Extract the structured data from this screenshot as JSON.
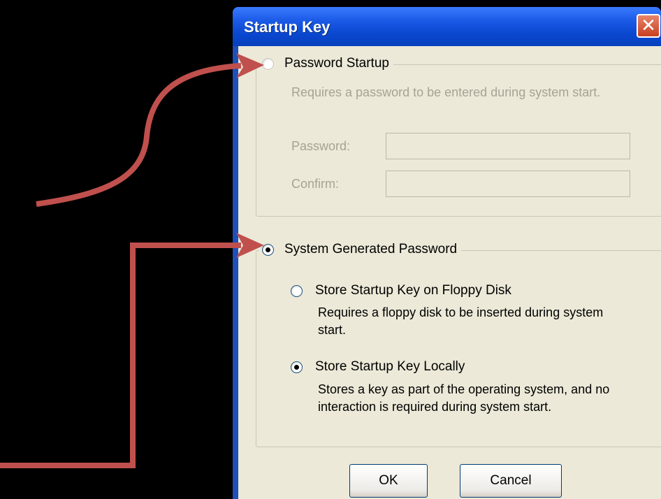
{
  "dialog": {
    "title": "Startup Key",
    "close_icon": "close-icon"
  },
  "password_startup": {
    "label": "Password Startup",
    "selected": false,
    "enabled": false,
    "description": "Requires a password to be entered during system start.",
    "password_label": "Password:",
    "confirm_label": "Confirm:",
    "password_value": "",
    "confirm_value": ""
  },
  "system_generated": {
    "label": "System Generated Password",
    "selected": true,
    "floppy": {
      "label": "Store Startup Key on Floppy Disk",
      "selected": false,
      "description": "Requires a floppy disk to be inserted during system start."
    },
    "local": {
      "label": "Store Startup Key Locally",
      "selected": true,
      "description": "Stores a key as part of the operating system, and no interaction is required during system start."
    }
  },
  "buttons": {
    "ok": "OK",
    "cancel": "Cancel"
  },
  "colors": {
    "annotation_arrow": "#c0504d",
    "titlebar": "#0a47cf",
    "dialog_bg": "#ece9d8"
  }
}
